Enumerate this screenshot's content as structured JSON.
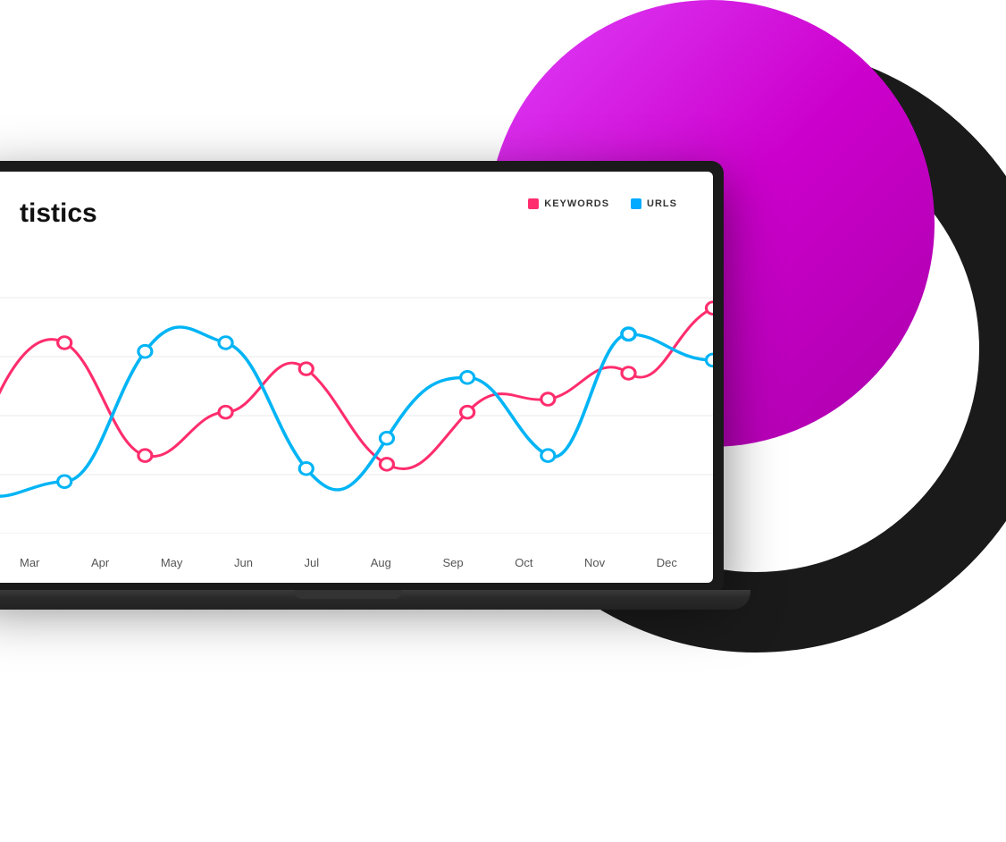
{
  "background": {
    "circle_color": "#1a1a1a",
    "inner_circle_gradient_start": "#e040fb",
    "inner_circle_gradient_end": "#aa00aa"
  },
  "chart": {
    "title": "tistics",
    "legend": {
      "keywords_label": "KEYWORDS",
      "urls_label": "URLS"
    },
    "x_axis_labels": [
      "Mar",
      "Apr",
      "May",
      "Jun",
      "Jul",
      "Aug",
      "Sep",
      "Oct",
      "Nov",
      "Dec"
    ],
    "keywords_color": "#ff2d6d",
    "urls_color": "#00b4f5",
    "grid_lines_count": 5
  }
}
